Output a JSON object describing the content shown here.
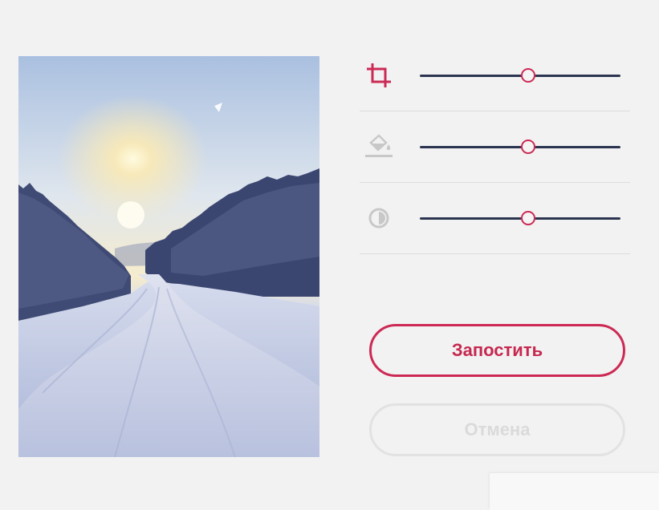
{
  "photo": {
    "alt": "winter-road-photo",
    "colors": {
      "sky_top": "#aac0e0",
      "sky_glow": "#fff3c8",
      "trees": "#3b4870",
      "snow": "#c7cfe7"
    }
  },
  "controls": {
    "accent": "#cc2a55",
    "track_color": "#2b3550",
    "rows": [
      {
        "icon": "crop-icon",
        "value": 0.54,
        "active": true
      },
      {
        "icon": "paint-bucket-icon",
        "value": 0.54,
        "active": false
      },
      {
        "icon": "contrast-icon",
        "value": 0.54,
        "active": false
      }
    ]
  },
  "buttons": {
    "post_label": "Запостить",
    "cancel_label": "Отмена"
  }
}
